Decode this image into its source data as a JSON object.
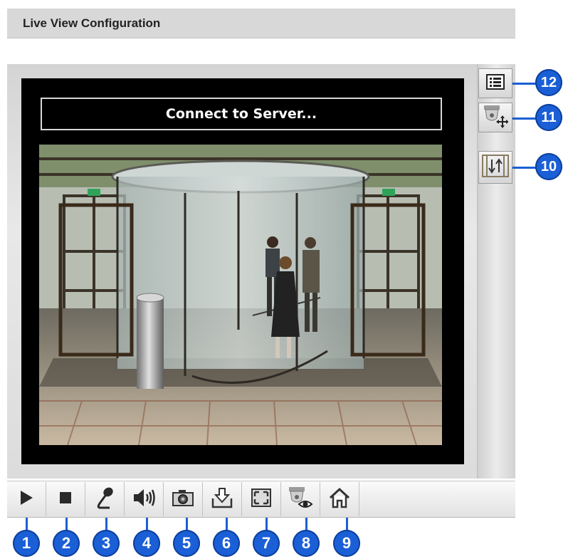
{
  "header": {
    "title": "Live View Configuration"
  },
  "viewer": {
    "status_text": "Connect to Server..."
  },
  "toolbar": {
    "buttons": [
      {
        "icon": "play-icon",
        "callout": "1"
      },
      {
        "icon": "stop-icon",
        "callout": "2"
      },
      {
        "icon": "microphone-icon",
        "callout": "3"
      },
      {
        "icon": "speaker-icon",
        "callout": "4"
      },
      {
        "icon": "camera-snapshot-icon",
        "callout": "5"
      },
      {
        "icon": "download-record-icon",
        "callout": "6"
      },
      {
        "icon": "fullscreen-icon",
        "callout": "7"
      },
      {
        "icon": "camera-view-icon",
        "callout": "8"
      },
      {
        "icon": "home-icon",
        "callout": "9"
      }
    ]
  },
  "sidebar": {
    "buttons": [
      {
        "icon": "list-icon",
        "callout": "12"
      },
      {
        "icon": "ptz-camera-icon",
        "callout": "11"
      },
      {
        "icon": "flip-icon",
        "callout": "10"
      }
    ]
  },
  "colors": {
    "callout_blue": "#1a5fd6",
    "viewer_bg": "#000000",
    "header_bg": "#d8d8d8"
  }
}
